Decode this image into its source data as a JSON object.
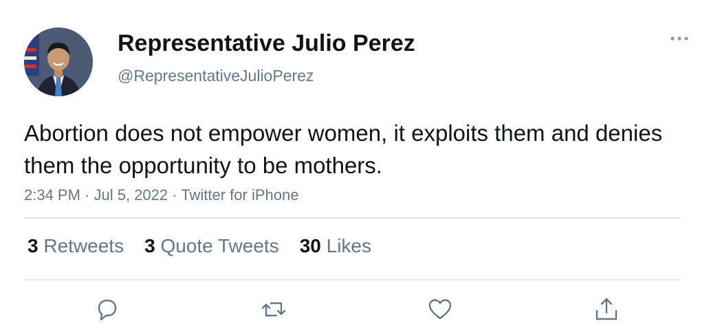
{
  "author": {
    "display_name": "Representative Julio Perez",
    "handle": "@RepresentativeJulioPerez",
    "avatar": "profile-photo"
  },
  "more_icon": "more-horizontal-icon",
  "tweet": {
    "text": "Abortion does not empower women, it exploits them and denies them the opportunity to be mothers.",
    "meta": "2:34 PM · Jul 5, 2022 · Twitter for iPhone"
  },
  "stats": {
    "retweets": {
      "count": "3",
      "label": "Retweets"
    },
    "quote_tweets": {
      "count": "3",
      "label": "Quote Tweets"
    },
    "likes": {
      "count": "30",
      "label": "Likes"
    }
  },
  "actions": [
    {
      "icon": "reply-icon"
    },
    {
      "icon": "retweet-icon"
    },
    {
      "icon": "like-icon"
    },
    {
      "icon": "share-icon"
    }
  ],
  "colors": {
    "text_primary": "#0f1419",
    "text_secondary": "#657786",
    "divider": "#e1e8ed"
  }
}
